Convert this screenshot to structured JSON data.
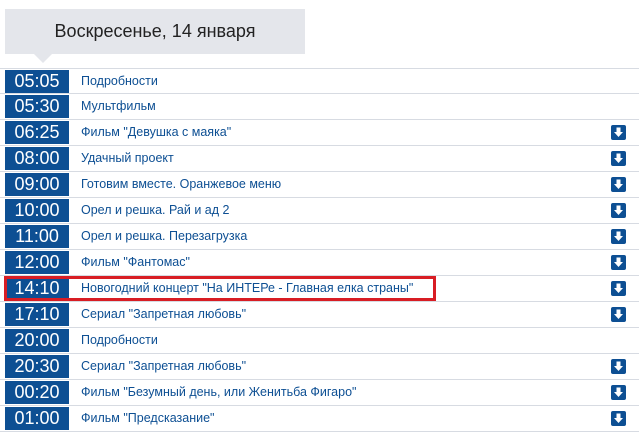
{
  "day_header": {
    "label": "Воскресенье, 14 января"
  },
  "schedule": [
    {
      "time": "05:05",
      "title": "Подробности",
      "expandable": false
    },
    {
      "time": "05:30",
      "title": "Мультфильм",
      "expandable": false
    },
    {
      "time": "06:25",
      "title": "Фильм \"Девушка с маяка\"",
      "expandable": true
    },
    {
      "time": "08:00",
      "title": "Удачный проект",
      "expandable": true
    },
    {
      "time": "09:00",
      "title": "Готовим вместе. Оранжевое меню",
      "expandable": true
    },
    {
      "time": "10:00",
      "title": "Орел и решка. Рай и ад 2",
      "expandable": true
    },
    {
      "time": "11:00",
      "title": "Орел и решка. Перезагрузка",
      "expandable": true
    },
    {
      "time": "12:00",
      "title": "Фильм \"Фантомас\"",
      "expandable": true
    },
    {
      "time": "14:10",
      "title": "Новогодний концерт \"На ИНТЕРе - Главная елка страны\"",
      "expandable": true,
      "highlighted": true
    },
    {
      "time": "17:10",
      "title": "Сериал \"Запретная любовь\"",
      "expandable": true
    },
    {
      "time": "20:00",
      "title": "Подробности",
      "expandable": false
    },
    {
      "time": "20:30",
      "title": "Сериал \"Запретная любовь\"",
      "expandable": true
    },
    {
      "time": "00:20",
      "title": "Фильм \"Безумный день, или Женитьба Фигаро\"",
      "expandable": true
    },
    {
      "time": "01:00",
      "title": "Фильм \"Предсказание\"",
      "expandable": true
    }
  ],
  "icons": {
    "expand": "arrow-down-icon"
  },
  "colors": {
    "accent": "#0d4f93",
    "highlight": "#d81d24",
    "header_bg": "#e4e6eb"
  }
}
